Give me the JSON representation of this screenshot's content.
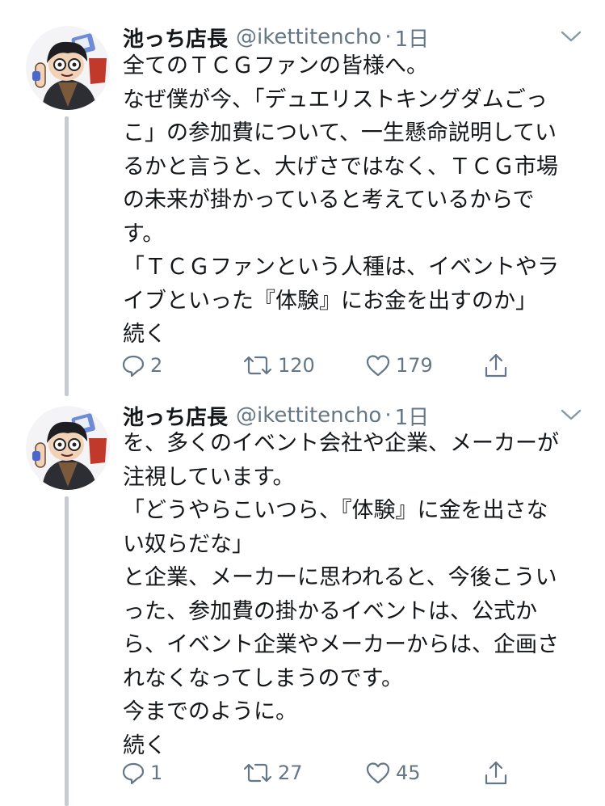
{
  "tweets": [
    {
      "name": "池っち店長",
      "handle": "@ikettitencho",
      "separator": "·",
      "time": "1日",
      "lines": [
        "全てのＴＣＧファンの皆様へ。",
        "なぜ僕が今、「デュエリストキングダムごっ",
        "こ」の参加費について、一生懸命説明してい",
        "るかと言うと、大げさではなく、ＴＣＧ市場",
        "の未来が掛かっていると考えているからで",
        "す。",
        "「ＴＣＧファンという人種は、イベントやラ",
        "イブといった『体験』にお金を出すのか」",
        "続く"
      ],
      "replies": "2",
      "retweets": "120",
      "likes": "179"
    },
    {
      "name": "池っち店長",
      "handle": "@ikettitencho",
      "separator": "·",
      "time": "1日",
      "lines": [
        "を、多くのイベント会社や企業、メーカーが",
        "注視しています。",
        "「どうやらこいつら、『体験』に金を出さな",
        "い奴らだな」",
        "と企業、メーカーに思われると、今後こうい",
        "った、参加費の掛かるイベントは、公式か",
        "ら、イベント企業やメーカーからは、企画さ",
        "れなくなってしまうのです。",
        "今までのように。",
        "続く"
      ],
      "replies": "1",
      "retweets": "27",
      "likes": "45"
    }
  ]
}
